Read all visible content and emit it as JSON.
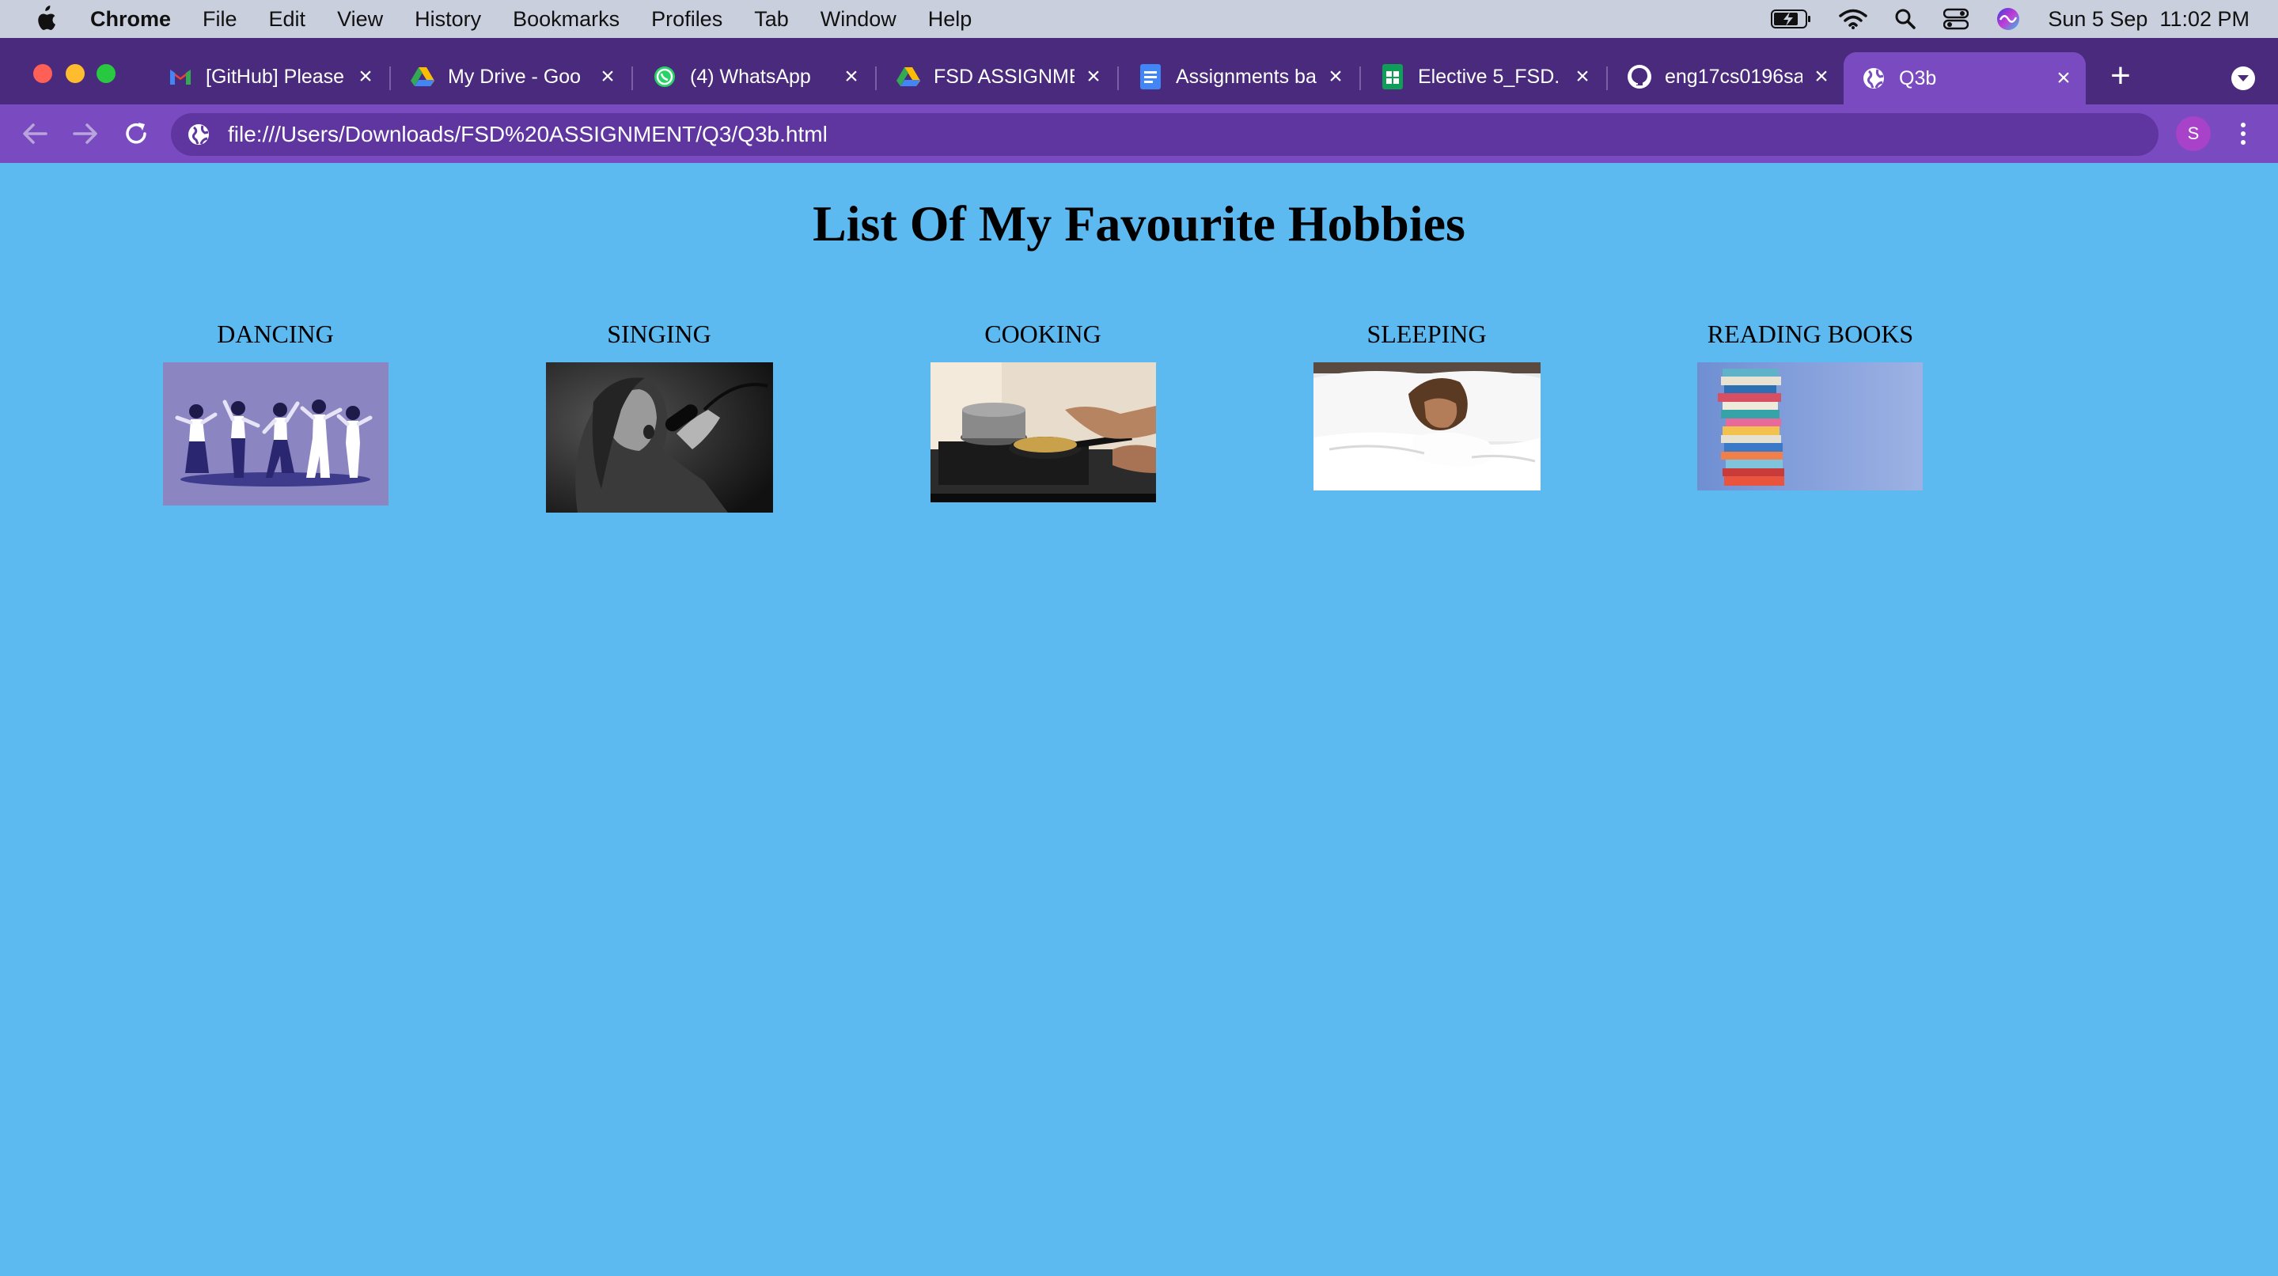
{
  "menubar": {
    "app_name": "Chrome",
    "menus": [
      "File",
      "Edit",
      "View",
      "History",
      "Bookmarks",
      "Profiles",
      "Tab",
      "Window",
      "Help"
    ],
    "datetime": "Sun 5 Sep  11:02 PM"
  },
  "tabs": [
    {
      "title": "[GitHub] Please",
      "icon": "gmail-icon"
    },
    {
      "title": "My Drive - Goo",
      "icon": "google-drive-icon"
    },
    {
      "title": "(4) WhatsApp",
      "icon": "whatsapp-icon"
    },
    {
      "title": "FSD ASSIGNME",
      "icon": "google-drive-icon"
    },
    {
      "title": "Assignments ba",
      "icon": "google-docs-icon"
    },
    {
      "title": "Elective 5_FSD.",
      "icon": "google-sheets-icon"
    },
    {
      "title": "eng17cs0196sa",
      "icon": "github-icon"
    },
    {
      "title": "Q3b",
      "icon": "globe-icon",
      "active": true
    }
  ],
  "address_bar": {
    "url": "file:///Users/Downloads/FSD%20ASSIGNMENT/Q3/Q3b.html"
  },
  "profile": {
    "initial": "S"
  },
  "page": {
    "title": "List Of My Favourite Hobbies",
    "hobbies": [
      {
        "label": "DANCING",
        "image": "dancing-image"
      },
      {
        "label": "SINGING",
        "image": "singing-image"
      },
      {
        "label": "COOKING",
        "image": "cooking-image"
      },
      {
        "label": "SLEEPING",
        "image": "sleeping-image"
      },
      {
        "label": "READING BOOKS",
        "image": "reading-books-image"
      }
    ]
  },
  "colors": {
    "page_background": "#5dbaf0",
    "tabstrip": "#4a2a7c",
    "toolbar": "#7a4bc0"
  }
}
